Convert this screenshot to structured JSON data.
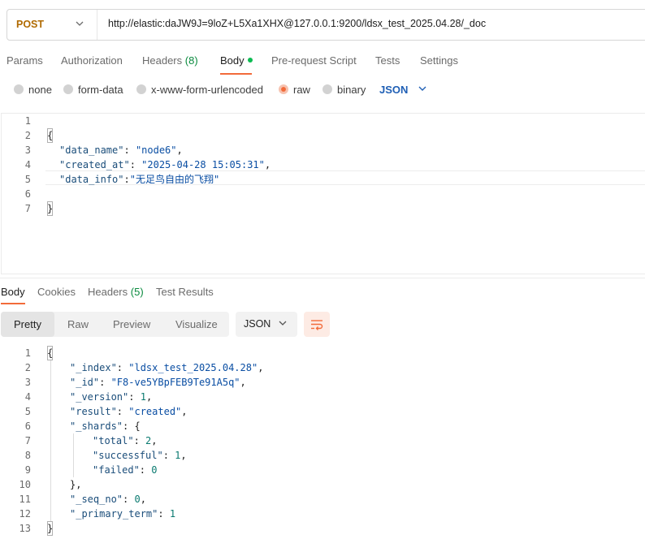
{
  "request": {
    "method": "POST",
    "url": "http://elastic:daJW9J=9loZ+L5Xa1XHX@127.0.0.1:9200/ldsx_test_2025.04.28/_doc"
  },
  "request_tabs": {
    "params": "Params",
    "authorization": "Authorization",
    "headers": "Headers",
    "headers_count": "(8)",
    "body": "Body",
    "prerequest": "Pre-request Script",
    "tests": "Tests",
    "settings": "Settings"
  },
  "body_options": {
    "none": "none",
    "form_data": "form-data",
    "urlencoded": "x-www-form-urlencoded",
    "raw": "raw",
    "binary": "binary",
    "language": "JSON",
    "selected": "raw"
  },
  "request_body": {
    "line_numbers": [
      "1",
      "2",
      "3",
      "4",
      "5",
      "6",
      "7"
    ],
    "open_brace": "{",
    "close_brace": "}",
    "fields": [
      {
        "key": "\"data_name\"",
        "value": "\"node6\"",
        "sep": ",",
        "colon": ": "
      },
      {
        "key": "\"created_at\"",
        "value": "\"2025-04-28 15:05:31\"",
        "sep": ",",
        "colon": ": "
      },
      {
        "key": "\"data_info\"",
        "value": "\"无足鸟自由的飞翔\"",
        "sep": "",
        "colon": ":"
      }
    ]
  },
  "response_tabs": {
    "body": "Body",
    "cookies": "Cookies",
    "headers": "Headers",
    "headers_count": "(5)",
    "test_results": "Test Results"
  },
  "view_modes": {
    "pretty": "Pretty",
    "raw": "Raw",
    "preview": "Preview",
    "visualize": "Visualize",
    "format": "JSON"
  },
  "response_body": {
    "line_numbers": [
      "1",
      "2",
      "3",
      "4",
      "5",
      "6",
      "7",
      "8",
      "9",
      "10",
      "11",
      "12",
      "13"
    ],
    "open_brace": "{",
    "close_brace": "}",
    "index_key": "\"_index\"",
    "index_val": "\"ldsx_test_2025.04.28\"",
    "id_key": "\"_id\"",
    "id_val": "\"F8-ve5YBpFEB9Te91A5q\"",
    "version_key": "\"_version\"",
    "version_val": "1",
    "result_key": "\"result\"",
    "result_val": "\"created\"",
    "shards_key": "\"_shards\"",
    "total_key": "\"total\"",
    "total_val": "2",
    "successful_key": "\"successful\"",
    "successful_val": "1",
    "failed_key": "\"failed\"",
    "failed_val": "0",
    "seq_no_key": "\"_seq_no\"",
    "seq_no_val": "0",
    "primary_term_key": "\"_primary_term\"",
    "primary_term_val": "1"
  },
  "colors": {
    "accent": "#f26b3a",
    "method": "#b06a00",
    "json_selector": "#1f5fb5",
    "status_dot": "#0cbb52"
  }
}
